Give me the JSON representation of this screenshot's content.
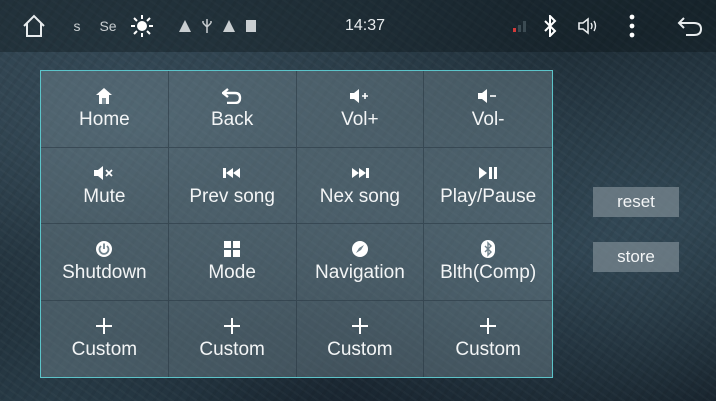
{
  "status_bar": {
    "left_text_1": "s",
    "left_text_2": "Se",
    "time": "14:37"
  },
  "grid": [
    {
      "label": "Home",
      "icon": "home-icon"
    },
    {
      "label": "Back",
      "icon": "back-icon"
    },
    {
      "label": "Vol+",
      "icon": "volume-up-icon"
    },
    {
      "label": "Vol-",
      "icon": "volume-down-icon"
    },
    {
      "label": "Mute",
      "icon": "mute-icon"
    },
    {
      "label": "Prev song",
      "icon": "previous-track-icon"
    },
    {
      "label": "Nex song",
      "icon": "next-track-icon"
    },
    {
      "label": "Play/Pause",
      "icon": "play-pause-icon"
    },
    {
      "label": "Shutdown",
      "icon": "power-icon"
    },
    {
      "label": "Mode",
      "icon": "mode-grid-icon"
    },
    {
      "label": "Navigation",
      "icon": "compass-icon"
    },
    {
      "label": "Blth(Comp)",
      "icon": "bluetooth-icon"
    },
    {
      "label": "Custom",
      "icon": "plus-icon"
    },
    {
      "label": "Custom",
      "icon": "plus-icon"
    },
    {
      "label": "Custom",
      "icon": "plus-icon"
    },
    {
      "label": "Custom",
      "icon": "plus-icon"
    }
  ],
  "buttons": {
    "reset": "reset",
    "store": "store"
  },
  "colors": {
    "panel_border": "#5cc3c9",
    "signal_red": "#d23a3a"
  }
}
